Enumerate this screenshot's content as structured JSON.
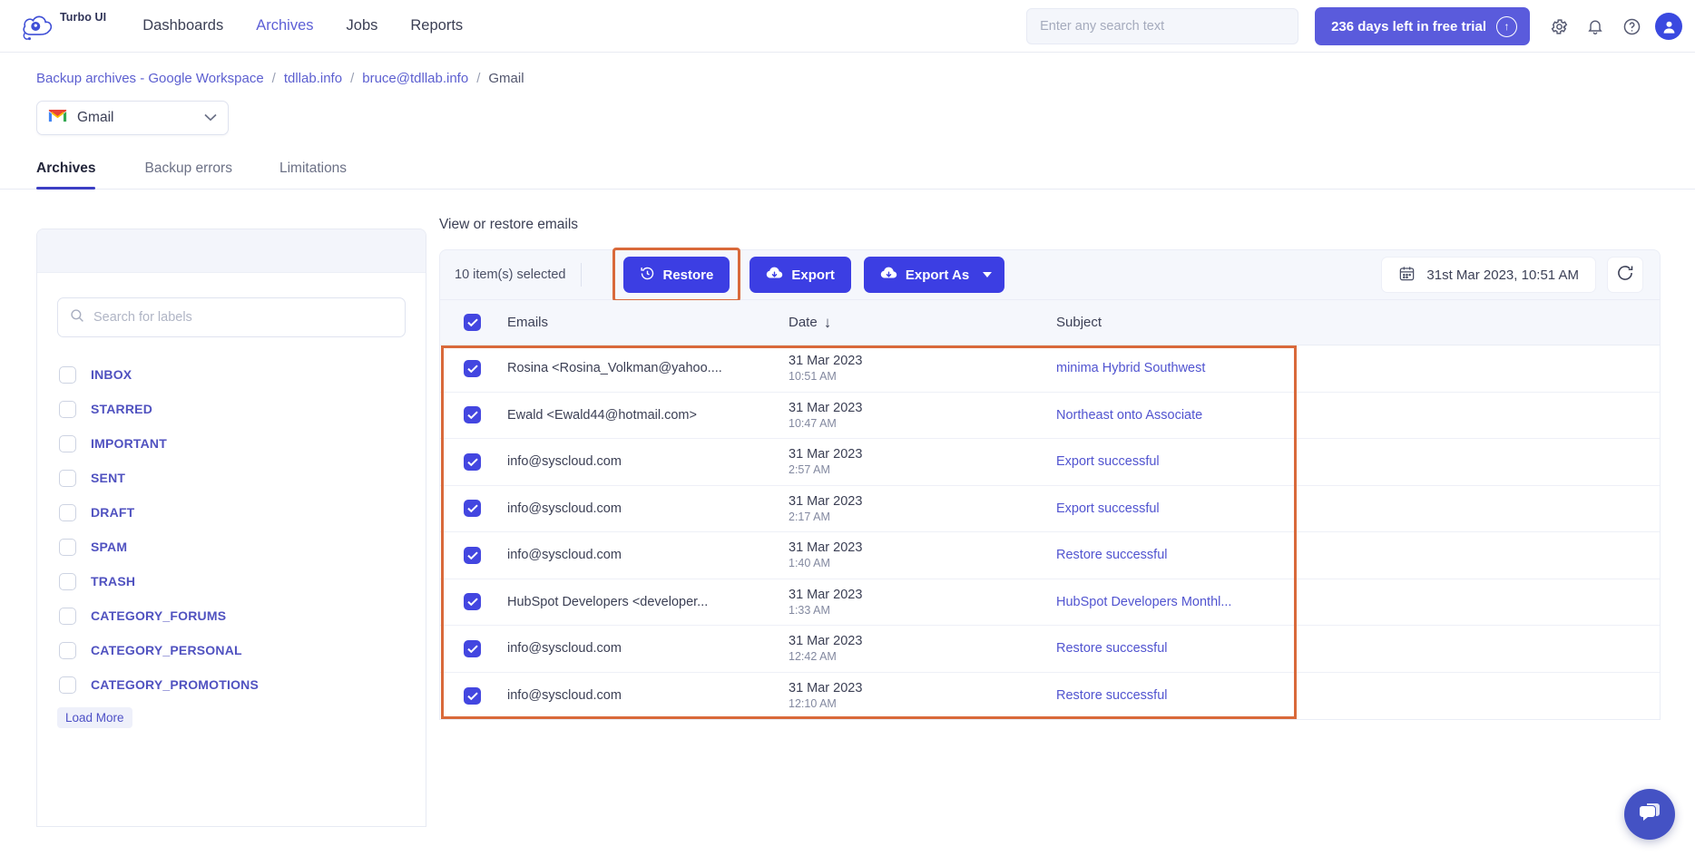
{
  "topnav": {
    "brand_name": "Turbo UI",
    "links": [
      {
        "label": "Dashboards",
        "active": false
      },
      {
        "label": "Archives",
        "active": true
      },
      {
        "label": "Jobs",
        "active": false
      },
      {
        "label": "Reports",
        "active": false
      }
    ],
    "search_placeholder": "Enter any search text",
    "search_value": "",
    "trial_label": "236 days left in free trial",
    "icons": [
      "gear-icon",
      "bell-icon",
      "help-icon",
      "user-avatar"
    ]
  },
  "breadcrumb": [
    {
      "label": "Backup archives - Google Workspace",
      "last": false
    },
    {
      "label": "tdllab.info",
      "last": false
    },
    {
      "label": "bruce@tdllab.info",
      "last": false
    },
    {
      "label": "Gmail",
      "last": true
    }
  ],
  "app_select": {
    "label": "Gmail",
    "icon": "gmail-icon"
  },
  "tabs": [
    {
      "label": "Archives",
      "active": true
    },
    {
      "label": "Backup errors",
      "active": false
    },
    {
      "label": "Limitations",
      "active": false
    }
  ],
  "sidebar": {
    "search_placeholder": "Search for labels",
    "search_value": "",
    "labels": [
      "INBOX",
      "STARRED",
      "IMPORTANT",
      "SENT",
      "DRAFT",
      "SPAM",
      "TRASH",
      "CATEGORY_FORUMS",
      "CATEGORY_PERSONAL",
      "CATEGORY_PROMOTIONS"
    ],
    "load_more": "Load More"
  },
  "main": {
    "title": "View or restore emails",
    "selected_count": "10 item(s) selected",
    "restore_label": "Restore",
    "export_label": "Export",
    "export_as_label": "Export As",
    "date_value": "31st Mar 2023, 10:51 AM",
    "columns": {
      "emails": "Emails",
      "date": "Date",
      "subject": "Subject"
    },
    "sort_indicator": "↓",
    "rows": [
      {
        "sender": "Rosina <Rosina_Volkman@yahoo....",
        "date": "31 Mar 2023",
        "time": "10:51 AM",
        "subject": "minima Hybrid Southwest",
        "checked": true
      },
      {
        "sender": "Ewald <Ewald44@hotmail.com>",
        "date": "31 Mar 2023",
        "time": "10:47 AM",
        "subject": "Northeast onto Associate",
        "checked": true
      },
      {
        "sender": "info@syscloud.com",
        "date": "31 Mar 2023",
        "time": "2:57 AM",
        "subject": "Export successful",
        "checked": true
      },
      {
        "sender": "info@syscloud.com",
        "date": "31 Mar 2023",
        "time": "2:17 AM",
        "subject": "Export successful",
        "checked": true
      },
      {
        "sender": "info@syscloud.com",
        "date": "31 Mar 2023",
        "time": "1:40 AM",
        "subject": "Restore successful",
        "checked": true
      },
      {
        "sender": "HubSpot Developers <developer...",
        "date": "31 Mar 2023",
        "time": "1:33 AM",
        "subject": "HubSpot Developers Monthl...",
        "checked": true
      },
      {
        "sender": "info@syscloud.com",
        "date": "31 Mar 2023",
        "time": "12:42 AM",
        "subject": "Restore successful",
        "checked": true
      },
      {
        "sender": "info@syscloud.com",
        "date": "31 Mar 2023",
        "time": "12:10 AM",
        "subject": "Restore successful",
        "checked": true
      }
    ]
  },
  "colors": {
    "accent": "#3c3ee3",
    "nav_active": "#5d5fd6",
    "highlight": "#d9693a",
    "label_text": "#5052c0",
    "link": "#5154d0"
  }
}
